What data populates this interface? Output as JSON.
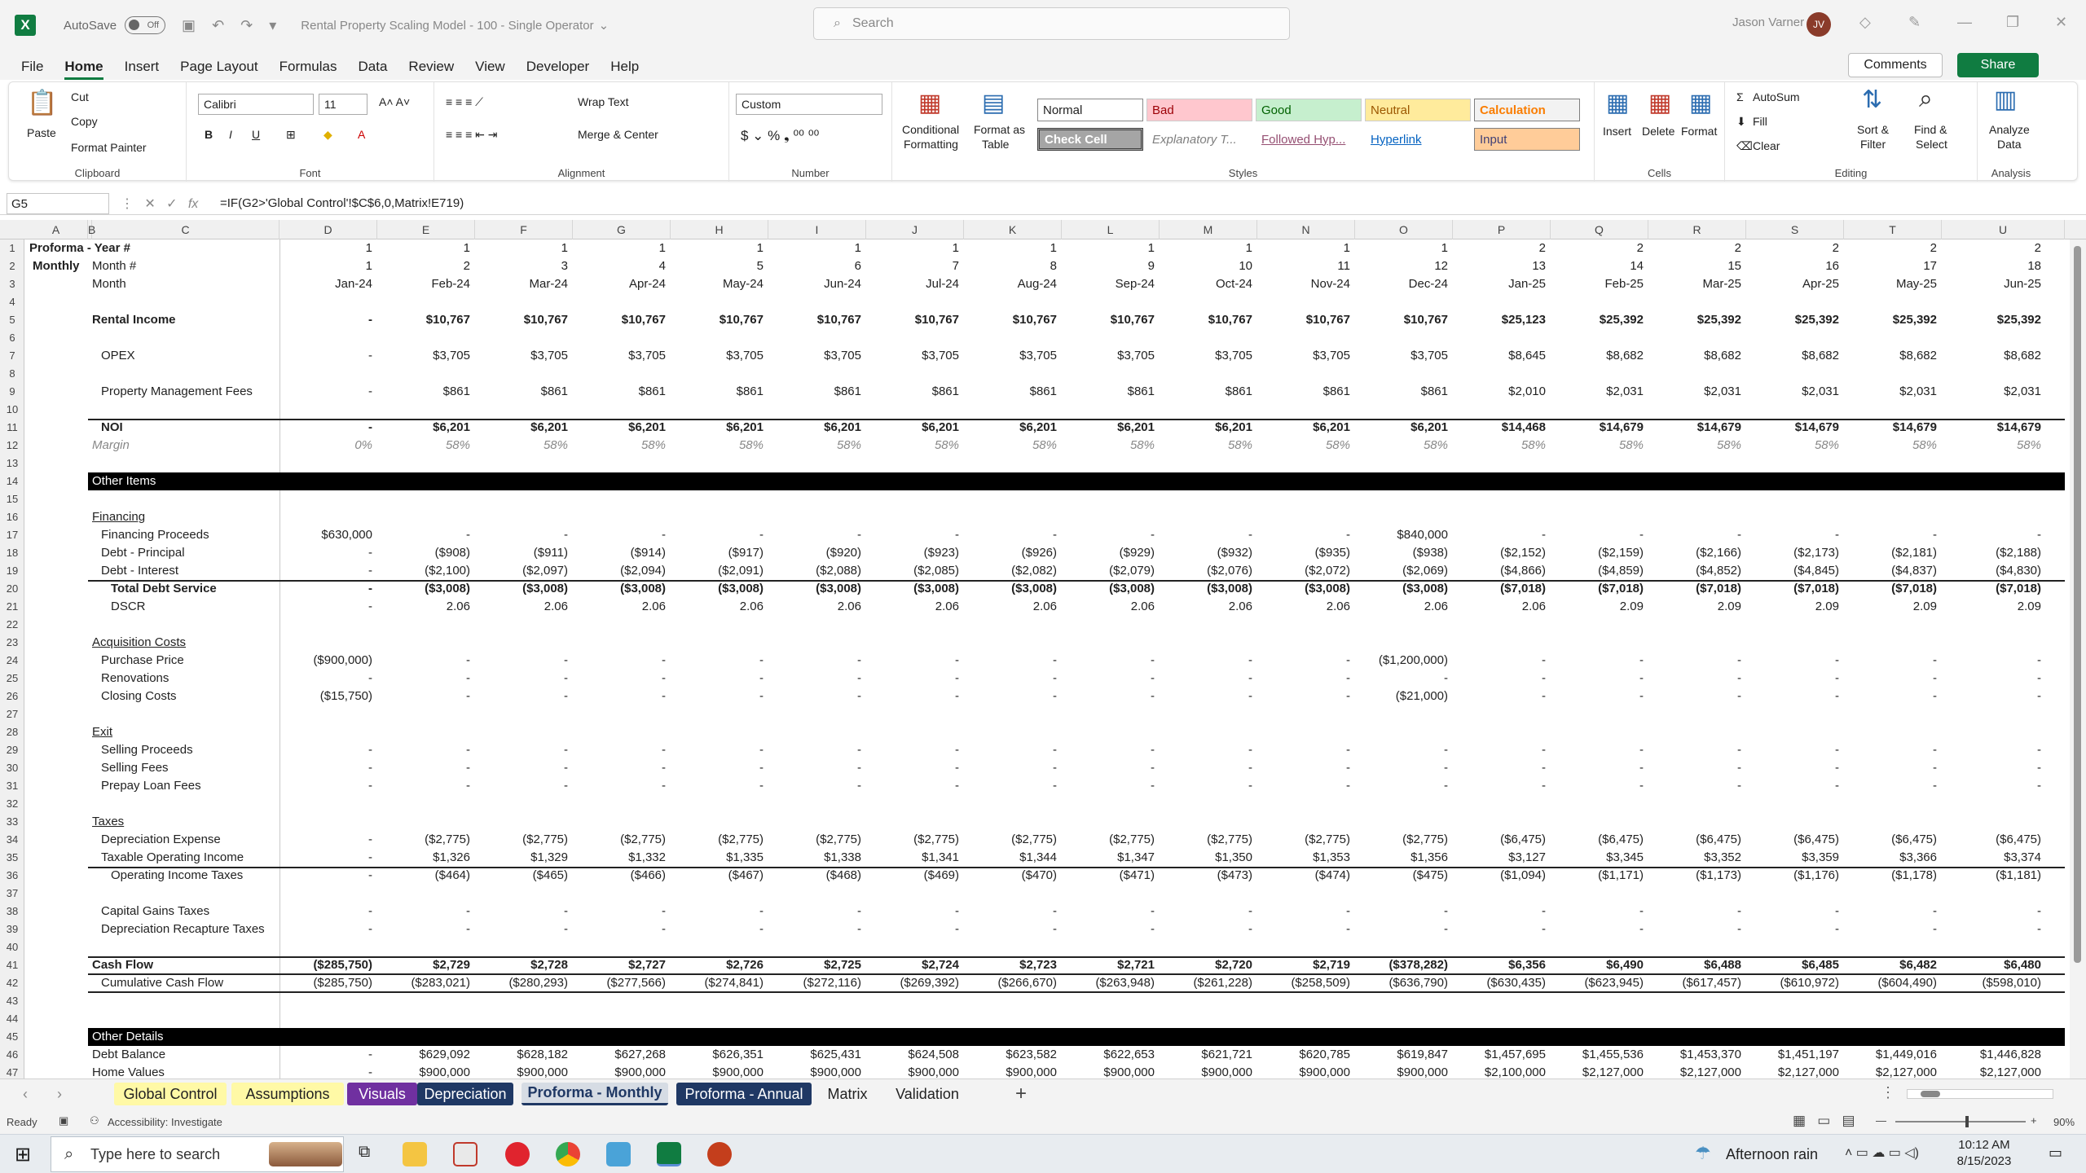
{
  "window": {
    "autosave": "AutoSave",
    "autosave_state": "Off",
    "title": "Rental Property Scaling Model - 100 - Single Operator",
    "search": "Search",
    "user": "Jason Varner",
    "user_initials": "JV"
  },
  "menu": [
    "File",
    "Home",
    "Insert",
    "Page Layout",
    "Formulas",
    "Data",
    "Review",
    "View",
    "Developer",
    "Help"
  ],
  "actions": {
    "comments": "Comments",
    "share": "Share"
  },
  "ribbon": {
    "clipboard": {
      "label": "Clipboard",
      "paste": "Paste",
      "cut": "Cut",
      "copy": "Copy",
      "format_painter": "Format Painter"
    },
    "font": {
      "label": "Font",
      "name": "Calibri",
      "size": "11"
    },
    "alignment": {
      "label": "Alignment",
      "wrap": "Wrap Text",
      "merge": "Merge & Center"
    },
    "number": {
      "label": "Number",
      "format": "Custom"
    },
    "styles": {
      "label": "Styles",
      "conditional": "Conditional",
      "conditional2": "Formatting",
      "format_as": "Format as",
      "format_as2": "Table",
      "cells": [
        "Normal",
        "Bad",
        "Good",
        "Neutral",
        "Calculation",
        "Check Cell",
        "Explanatory T...",
        "Followed Hyp...",
        "Hyperlink",
        "Input"
      ]
    },
    "cells": {
      "label": "Cells",
      "insert": "Insert",
      "delete": "Delete",
      "format": "Format"
    },
    "editing": {
      "label": "Editing",
      "autosum": "AutoSum",
      "fill": "Fill",
      "clear": "Clear",
      "sort": "Sort &",
      "sort2": "Filter",
      "find": "Find &",
      "find2": "Select"
    },
    "analysis": {
      "label": "Analysis",
      "analyze": "Analyze",
      "analyze2": "Data"
    }
  },
  "formula_bar": {
    "cell": "G5",
    "formula": "=IF(G2>'Global Control'!$C$6,0,Matrix!E719)"
  },
  "columns": [
    "A",
    "B",
    "C",
    "D",
    "E",
    "F",
    "G",
    "H",
    "I",
    "J",
    "K",
    "L",
    "M",
    "N",
    "O",
    "P",
    "Q",
    "R",
    "S",
    "T",
    "U"
  ],
  "header_rows": {
    "r1": {
      "a": "Proforma - Year #",
      "vals": [
        "1",
        "1",
        "1",
        "1",
        "1",
        "1",
        "1",
        "1",
        "1",
        "1",
        "1",
        "1",
        "2",
        "2",
        "2",
        "2",
        "2",
        "2"
      ]
    },
    "r2": {
      "a": "Monthly",
      "c": "Month #",
      "vals": [
        "1",
        "2",
        "3",
        "4",
        "5",
        "6",
        "7",
        "8",
        "9",
        "10",
        "11",
        "12",
        "13",
        "14",
        "15",
        "16",
        "17",
        "18"
      ]
    },
    "r3": {
      "c": "Month",
      "vals": [
        "Jan-24",
        "Feb-24",
        "Mar-24",
        "Apr-24",
        "May-24",
        "Jun-24",
        "Jul-24",
        "Aug-24",
        "Sep-24",
        "Oct-24",
        "Nov-24",
        "Dec-24",
        "Jan-25",
        "Feb-25",
        "Mar-25",
        "Apr-25",
        "May-25",
        "Jun-25"
      ]
    }
  },
  "rows": [
    {
      "n": 5,
      "label": "Rental Income",
      "bold": true,
      "vals": [
        "-",
        "$10,767",
        "$10,767",
        "$10,767",
        "$10,767",
        "$10,767",
        "$10,767",
        "$10,767",
        "$10,767",
        "$10,767",
        "$10,767",
        "$10,767",
        "$25,123",
        "$25,392",
        "$25,392",
        "$25,392",
        "$25,392",
        "$25,392"
      ]
    },
    {
      "n": 7,
      "label": "OPEX",
      "indent": true,
      "vals": [
        "-",
        "$3,705",
        "$3,705",
        "$3,705",
        "$3,705",
        "$3,705",
        "$3,705",
        "$3,705",
        "$3,705",
        "$3,705",
        "$3,705",
        "$3,705",
        "$8,645",
        "$8,682",
        "$8,682",
        "$8,682",
        "$8,682",
        "$8,682"
      ]
    },
    {
      "n": 9,
      "label": "Property Management Fees",
      "indent": true,
      "vals": [
        "-",
        "$861",
        "$861",
        "$861",
        "$861",
        "$861",
        "$861",
        "$861",
        "$861",
        "$861",
        "$861",
        "$861",
        "$2,010",
        "$2,031",
        "$2,031",
        "$2,031",
        "$2,031",
        "$2,031"
      ]
    },
    {
      "n": 11,
      "label": "NOI",
      "bold": true,
      "indent": true,
      "vals": [
        "-",
        "$6,201",
        "$6,201",
        "$6,201",
        "$6,201",
        "$6,201",
        "$6,201",
        "$6,201",
        "$6,201",
        "$6,201",
        "$6,201",
        "$6,201",
        "$14,468",
        "$14,679",
        "$14,679",
        "$14,679",
        "$14,679",
        "$14,679"
      ]
    },
    {
      "n": 12,
      "label": "Margin",
      "italic": true,
      "vals": [
        "0%",
        "58%",
        "58%",
        "58%",
        "58%",
        "58%",
        "58%",
        "58%",
        "58%",
        "58%",
        "58%",
        "58%",
        "58%",
        "58%",
        "58%",
        "58%",
        "58%",
        "58%"
      ]
    },
    {
      "n": 17,
      "label": "Financing Proceeds",
      "indent": true,
      "vals": [
        "$630,000",
        "-",
        "-",
        "-",
        "-",
        "-",
        "-",
        "-",
        "-",
        "-",
        "-",
        "$840,000",
        "-",
        "-",
        "-",
        "-",
        "-",
        "-"
      ]
    },
    {
      "n": 18,
      "label": "Debt - Principal",
      "indent": true,
      "vals": [
        "-",
        "($908)",
        "($911)",
        "($914)",
        "($917)",
        "($920)",
        "($923)",
        "($926)",
        "($929)",
        "($932)",
        "($935)",
        "($938)",
        "($2,152)",
        "($2,159)",
        "($2,166)",
        "($2,173)",
        "($2,181)",
        "($2,188)"
      ]
    },
    {
      "n": 19,
      "label": "Debt - Interest",
      "indent": true,
      "vals": [
        "-",
        "($2,100)",
        "($2,097)",
        "($2,094)",
        "($2,091)",
        "($2,088)",
        "($2,085)",
        "($2,082)",
        "($2,079)",
        "($2,076)",
        "($2,072)",
        "($2,069)",
        "($4,866)",
        "($4,859)",
        "($4,852)",
        "($4,845)",
        "($4,837)",
        "($4,830)"
      ]
    },
    {
      "n": 20,
      "label": "Total Debt Service",
      "bold": true,
      "indent2": true,
      "vals": [
        "-",
        "($3,008)",
        "($3,008)",
        "($3,008)",
        "($3,008)",
        "($3,008)",
        "($3,008)",
        "($3,008)",
        "($3,008)",
        "($3,008)",
        "($3,008)",
        "($3,008)",
        "($7,018)",
        "($7,018)",
        "($7,018)",
        "($7,018)",
        "($7,018)",
        "($7,018)"
      ]
    },
    {
      "n": 21,
      "label": "DSCR",
      "indent2": true,
      "vals": [
        "-",
        "2.06",
        "2.06",
        "2.06",
        "2.06",
        "2.06",
        "2.06",
        "2.06",
        "2.06",
        "2.06",
        "2.06",
        "2.06",
        "2.06",
        "2.09",
        "2.09",
        "2.09",
        "2.09",
        "2.09"
      ]
    },
    {
      "n": 24,
      "label": "Purchase Price",
      "indent": true,
      "vals": [
        "($900,000)",
        "-",
        "-",
        "-",
        "-",
        "-",
        "-",
        "-",
        "-",
        "-",
        "-",
        "($1,200,000)",
        "-",
        "-",
        "-",
        "-",
        "-",
        "-"
      ]
    },
    {
      "n": 25,
      "label": "Renovations",
      "indent": true,
      "vals": [
        "-",
        "-",
        "-",
        "-",
        "-",
        "-",
        "-",
        "-",
        "-",
        "-",
        "-",
        "-",
        "-",
        "-",
        "-",
        "-",
        "-",
        "-"
      ]
    },
    {
      "n": 26,
      "label": "Closing Costs",
      "indent": true,
      "vals": [
        "($15,750)",
        "-",
        "-",
        "-",
        "-",
        "-",
        "-",
        "-",
        "-",
        "-",
        "-",
        "($21,000)",
        "-",
        "-",
        "-",
        "-",
        "-",
        "-"
      ]
    },
    {
      "n": 29,
      "label": "Selling Proceeds",
      "indent": true,
      "vals": [
        "-",
        "-",
        "-",
        "-",
        "-",
        "-",
        "-",
        "-",
        "-",
        "-",
        "-",
        "-",
        "-",
        "-",
        "-",
        "-",
        "-",
        "-"
      ]
    },
    {
      "n": 30,
      "label": "Selling Fees",
      "indent": true,
      "vals": [
        "-",
        "-",
        "-",
        "-",
        "-",
        "-",
        "-",
        "-",
        "-",
        "-",
        "-",
        "-",
        "-",
        "-",
        "-",
        "-",
        "-",
        "-"
      ]
    },
    {
      "n": 31,
      "label": "Prepay Loan Fees",
      "indent": true,
      "vals": [
        "-",
        "-",
        "-",
        "-",
        "-",
        "-",
        "-",
        "-",
        "-",
        "-",
        "-",
        "-",
        "-",
        "-",
        "-",
        "-",
        "-",
        "-"
      ]
    },
    {
      "n": 34,
      "label": "Depreciation Expense",
      "indent": true,
      "vals": [
        "-",
        "($2,775)",
        "($2,775)",
        "($2,775)",
        "($2,775)",
        "($2,775)",
        "($2,775)",
        "($2,775)",
        "($2,775)",
        "($2,775)",
        "($2,775)",
        "($2,775)",
        "($6,475)",
        "($6,475)",
        "($6,475)",
        "($6,475)",
        "($6,475)",
        "($6,475)"
      ]
    },
    {
      "n": 35,
      "label": "Taxable Operating Income",
      "indent": true,
      "vals": [
        "-",
        "$1,326",
        "$1,329",
        "$1,332",
        "$1,335",
        "$1,338",
        "$1,341",
        "$1,344",
        "$1,347",
        "$1,350",
        "$1,353",
        "$1,356",
        "$3,127",
        "$3,345",
        "$3,352",
        "$3,359",
        "$3,366",
        "$3,374"
      ]
    },
    {
      "n": 36,
      "label": "Operating Income Taxes",
      "indent2": true,
      "vals": [
        "-",
        "($464)",
        "($465)",
        "($466)",
        "($467)",
        "($468)",
        "($469)",
        "($470)",
        "($471)",
        "($473)",
        "($474)",
        "($475)",
        "($1,094)",
        "($1,171)",
        "($1,173)",
        "($1,176)",
        "($1,178)",
        "($1,181)"
      ]
    },
    {
      "n": 38,
      "label": "Capital Gains Taxes",
      "indent": true,
      "vals": [
        "-",
        "-",
        "-",
        "-",
        "-",
        "-",
        "-",
        "-",
        "-",
        "-",
        "-",
        "-",
        "-",
        "-",
        "-",
        "-",
        "-",
        "-"
      ]
    },
    {
      "n": 39,
      "label": "Depreciation Recapture Taxes",
      "indent": true,
      "vals": [
        "-",
        "-",
        "-",
        "-",
        "-",
        "-",
        "-",
        "-",
        "-",
        "-",
        "-",
        "-",
        "-",
        "-",
        "-",
        "-",
        "-",
        "-"
      ]
    },
    {
      "n": 41,
      "label": "Cash Flow",
      "bold": true,
      "vals": [
        "($285,750)",
        "$2,729",
        "$2,728",
        "$2,727",
        "$2,726",
        "$2,725",
        "$2,724",
        "$2,723",
        "$2,721",
        "$2,720",
        "$2,719",
        "($378,282)",
        "$6,356",
        "$6,490",
        "$6,488",
        "$6,485",
        "$6,482",
        "$6,480"
      ]
    },
    {
      "n": 42,
      "label": "Cumulative Cash Flow",
      "indent": true,
      "vals": [
        "($285,750)",
        "($283,021)",
        "($280,293)",
        "($277,566)",
        "($274,841)",
        "($272,116)",
        "($269,392)",
        "($266,670)",
        "($263,948)",
        "($261,228)",
        "($258,509)",
        "($636,790)",
        "($630,435)",
        "($623,945)",
        "($617,457)",
        "($610,972)",
        "($604,490)",
        "($598,010)"
      ]
    },
    {
      "n": 46,
      "label": "Debt Balance",
      "vals": [
        "-",
        "$629,092",
        "$628,182",
        "$627,268",
        "$626,351",
        "$625,431",
        "$624,508",
        "$623,582",
        "$622,653",
        "$621,721",
        "$620,785",
        "$619,847",
        "$1,457,695",
        "$1,455,536",
        "$1,453,370",
        "$1,451,197",
        "$1,449,016",
        "$1,446,828"
      ]
    },
    {
      "n": 47,
      "label": "Home Values",
      "vals": [
        "-",
        "$900,000",
        "$900,000",
        "$900,000",
        "$900,000",
        "$900,000",
        "$900,000",
        "$900,000",
        "$900,000",
        "$900,000",
        "$900,000",
        "$900,000",
        "$2,100,000",
        "$2,127,000",
        "$2,127,000",
        "$2,127,000",
        "$2,127,000",
        "$2,127,000"
      ]
    }
  ],
  "sections": [
    {
      "n": 14,
      "label": "Other Items"
    },
    {
      "n": 45,
      "label": "Other Details"
    }
  ],
  "subheads": [
    {
      "n": 16,
      "label": "Financing"
    },
    {
      "n": 23,
      "label": "Acquisition Costs"
    },
    {
      "n": 28,
      "label": "Exit"
    },
    {
      "n": 33,
      "label": "Taxes"
    }
  ],
  "tabs": [
    {
      "label": "Global Control",
      "bg": "#fff9a6",
      "fg": "#222"
    },
    {
      "label": "Assumptions",
      "bg": "#fff9a6",
      "fg": "#222"
    },
    {
      "label": "Visuals",
      "bg": "#7030a0",
      "fg": "#ffffff"
    },
    {
      "label": "Depreciation",
      "bg": "#1f3864",
      "fg": "#ffffff"
    },
    {
      "label": "Proforma - Monthly",
      "bg": "#d6dce4",
      "fg": "#1f3864",
      "active": true
    },
    {
      "label": "Proforma - Annual",
      "bg": "#1f3864",
      "fg": "#ffffff"
    },
    {
      "label": "Matrix",
      "bg": "",
      "fg": "#222"
    },
    {
      "label": "Validation",
      "bg": "",
      "fg": "#222"
    }
  ],
  "status": {
    "ready": "Ready",
    "accessibility": "Accessibility: Investigate",
    "zoom": "90%"
  },
  "taskbar": {
    "search": "Type here to search",
    "weather": "Afternoon rain",
    "time": "10:12 AM",
    "date": "8/15/2023"
  }
}
